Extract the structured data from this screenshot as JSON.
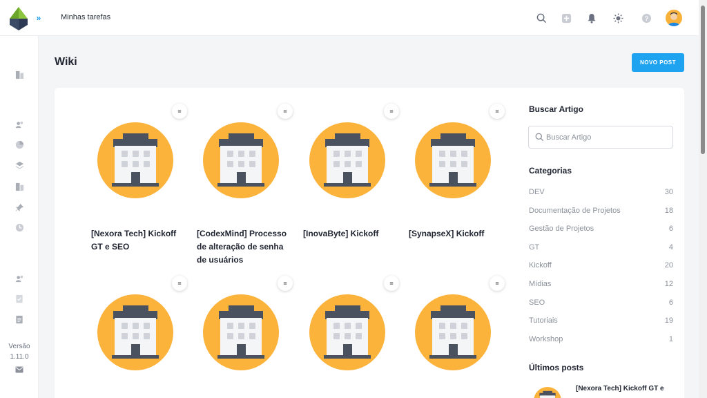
{
  "topbar": {
    "title": "Minhas tarefas",
    "icons": [
      "search-icon",
      "add-icon",
      "bell-icon",
      "sun-icon",
      "help-icon",
      "avatar"
    ]
  },
  "page": {
    "title": "Wiki",
    "new_post_label": "NOVO POST"
  },
  "posts": [
    {
      "title": "[Nexora Tech] Kickoff GT e SEO",
      "icon": "building-icon"
    },
    {
      "title": "[CodexMind] Processo de alteração de senha de usuários",
      "icon": "building-icon"
    },
    {
      "title": "[InovaByte] Kickoff",
      "icon": "building-icon"
    },
    {
      "title": "[SynapseX] Kickoff",
      "icon": "building-icon"
    },
    {
      "title": "",
      "icon": "building-icon"
    },
    {
      "title": "",
      "icon": "building-icon"
    },
    {
      "title": "",
      "icon": "building-icon"
    },
    {
      "title": "",
      "icon": "building-icon"
    }
  ],
  "search": {
    "heading": "Buscar Artigo",
    "placeholder": "Buscar Artigo"
  },
  "categories": {
    "heading": "Categorias",
    "items": [
      {
        "name": "DEV",
        "count": "30"
      },
      {
        "name": "Documentação de Projetos",
        "count": "18"
      },
      {
        "name": "Gestão de Projetos",
        "count": "6"
      },
      {
        "name": "GT",
        "count": "4"
      },
      {
        "name": "Kickoff",
        "count": "20"
      },
      {
        "name": "Mídias",
        "count": "12"
      },
      {
        "name": "SEO",
        "count": "6"
      },
      {
        "name": "Tutoriais",
        "count": "19"
      },
      {
        "name": "Workshop",
        "count": "1"
      }
    ]
  },
  "latest": {
    "heading": "Últimos posts",
    "items": [
      {
        "title": "[Nexora Tech] Kickoff GT e"
      }
    ]
  },
  "sidebar": {
    "version_label": "Versão",
    "version_number": "1.11.0"
  },
  "colors": {
    "accent": "#1ea3f0",
    "thumb_bg": "#fbb33c",
    "building": "#4a5260"
  }
}
